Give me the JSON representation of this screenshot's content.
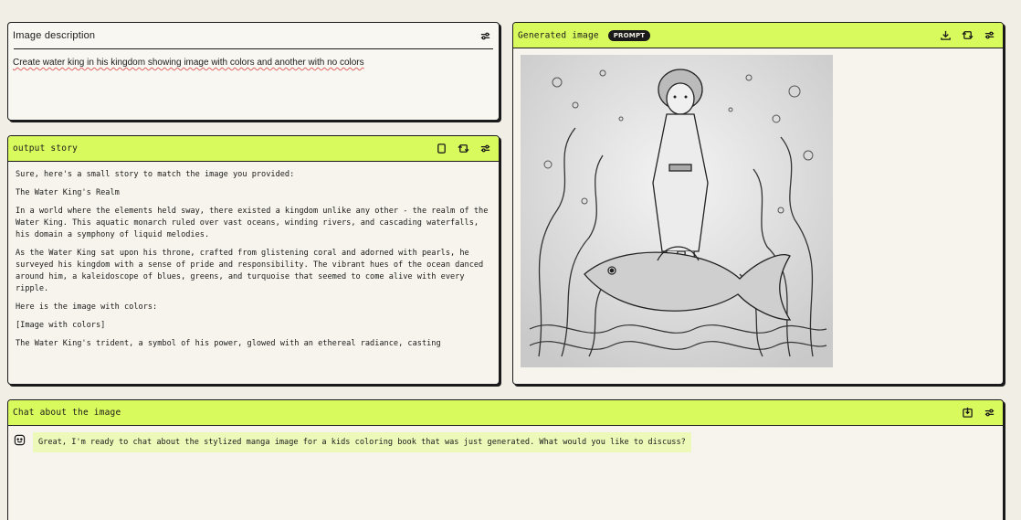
{
  "description_panel": {
    "title": "Image description",
    "text": "Create water king in his kingdom showing image with colors and another with no colors"
  },
  "story_panel": {
    "title": "output story",
    "paragraphs": [
      "Sure, here's a small story to match the image you provided:",
      "The Water King's Realm",
      "In a world where the elements held sway, there existed a kingdom unlike any other - the realm of the Water King. This aquatic monarch ruled over vast oceans, winding rivers, and cascading waterfalls, his domain a symphony of liquid melodies.",
      "As the Water King sat upon his throne, crafted from glistening coral and adorned with pearls, he surveyed his kingdom with a sense of pride and responsibility. The vibrant hues of the ocean danced around him, a kaleidoscope of blues, greens, and turquoise that seemed to come alive with every ripple.",
      "Here is the image with colors:",
      "[Image with colors]",
      "The Water King's trident, a symbol of his power, glowed with an ethereal radiance, casting"
    ]
  },
  "image_panel": {
    "title": "Generated image",
    "badge": "PROMPT"
  },
  "chat_panel": {
    "title": "Chat about the image",
    "message": "Great, I'm ready to chat about the stylized manga image for a kids coloring book that was just generated. What would you like to discuss?"
  },
  "colors": {
    "accent": "#d9fa5c",
    "background": "#f1efe5",
    "border": "#1a1a1a"
  }
}
